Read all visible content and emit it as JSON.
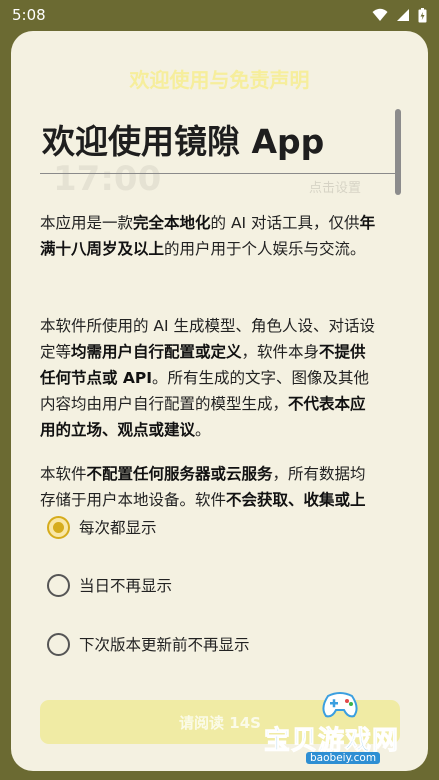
{
  "status_bar": {
    "time": "5:08",
    "icons": [
      "wifi-icon",
      "signal-icon",
      "battery-icon"
    ]
  },
  "dialog": {
    "header": "欢迎使用与免责声明",
    "title": "欢迎使用镜隙 App",
    "ghost_number": "17:00",
    "ghost_label": "点击设置",
    "paragraphs": [
      [
        {
          "t": "本应用是一款",
          "b": false
        },
        {
          "t": "完全本地化",
          "b": true
        },
        {
          "t": "的 AI 对话工具，仅供",
          "b": false
        },
        {
          "t": "年满十八周岁及以上",
          "b": true
        },
        {
          "t": "的用户用于个人娱乐与交流。",
          "b": false
        }
      ],
      [
        {
          "t": "本软件所使用的 AI 生成模型、角色人设、对话设定等",
          "b": false
        },
        {
          "t": "均需用户自行配置或定义",
          "b": true
        },
        {
          "t": "，软件本身",
          "b": false
        },
        {
          "t": "不提供任何节点或 API",
          "b": true
        },
        {
          "t": "。所有生成的文字、图像及其他内容均由用户自行配置的模型生成，",
          "b": false
        },
        {
          "t": "不代表本应用的立场、观点或建议",
          "b": true
        },
        {
          "t": "。",
          "b": false
        }
      ],
      [
        {
          "t": "本软件",
          "b": false
        },
        {
          "t": "不配置任何服务器或云服务",
          "b": true
        },
        {
          "t": "，所有数据均存储于用户本地设备。软件",
          "b": false
        },
        {
          "t": "不会获取、收集或上",
          "b": true
        }
      ]
    ],
    "options": [
      {
        "label": "每次都显示",
        "selected": true
      },
      {
        "label": "当日不再显示",
        "selected": false
      },
      {
        "label": "下次版本更新前不再显示",
        "selected": false
      }
    ],
    "confirm_button": "请阅读 14S"
  },
  "watermark": {
    "text": "宝贝游戏网",
    "url": "baobeiy.com"
  },
  "colors": {
    "backdrop": "#6b6a32",
    "dialog_bg": "#f4f1e1",
    "accent": "#d6ac1c",
    "button_disabled": "#f0eba4",
    "header_text": "#f6ee9c"
  }
}
